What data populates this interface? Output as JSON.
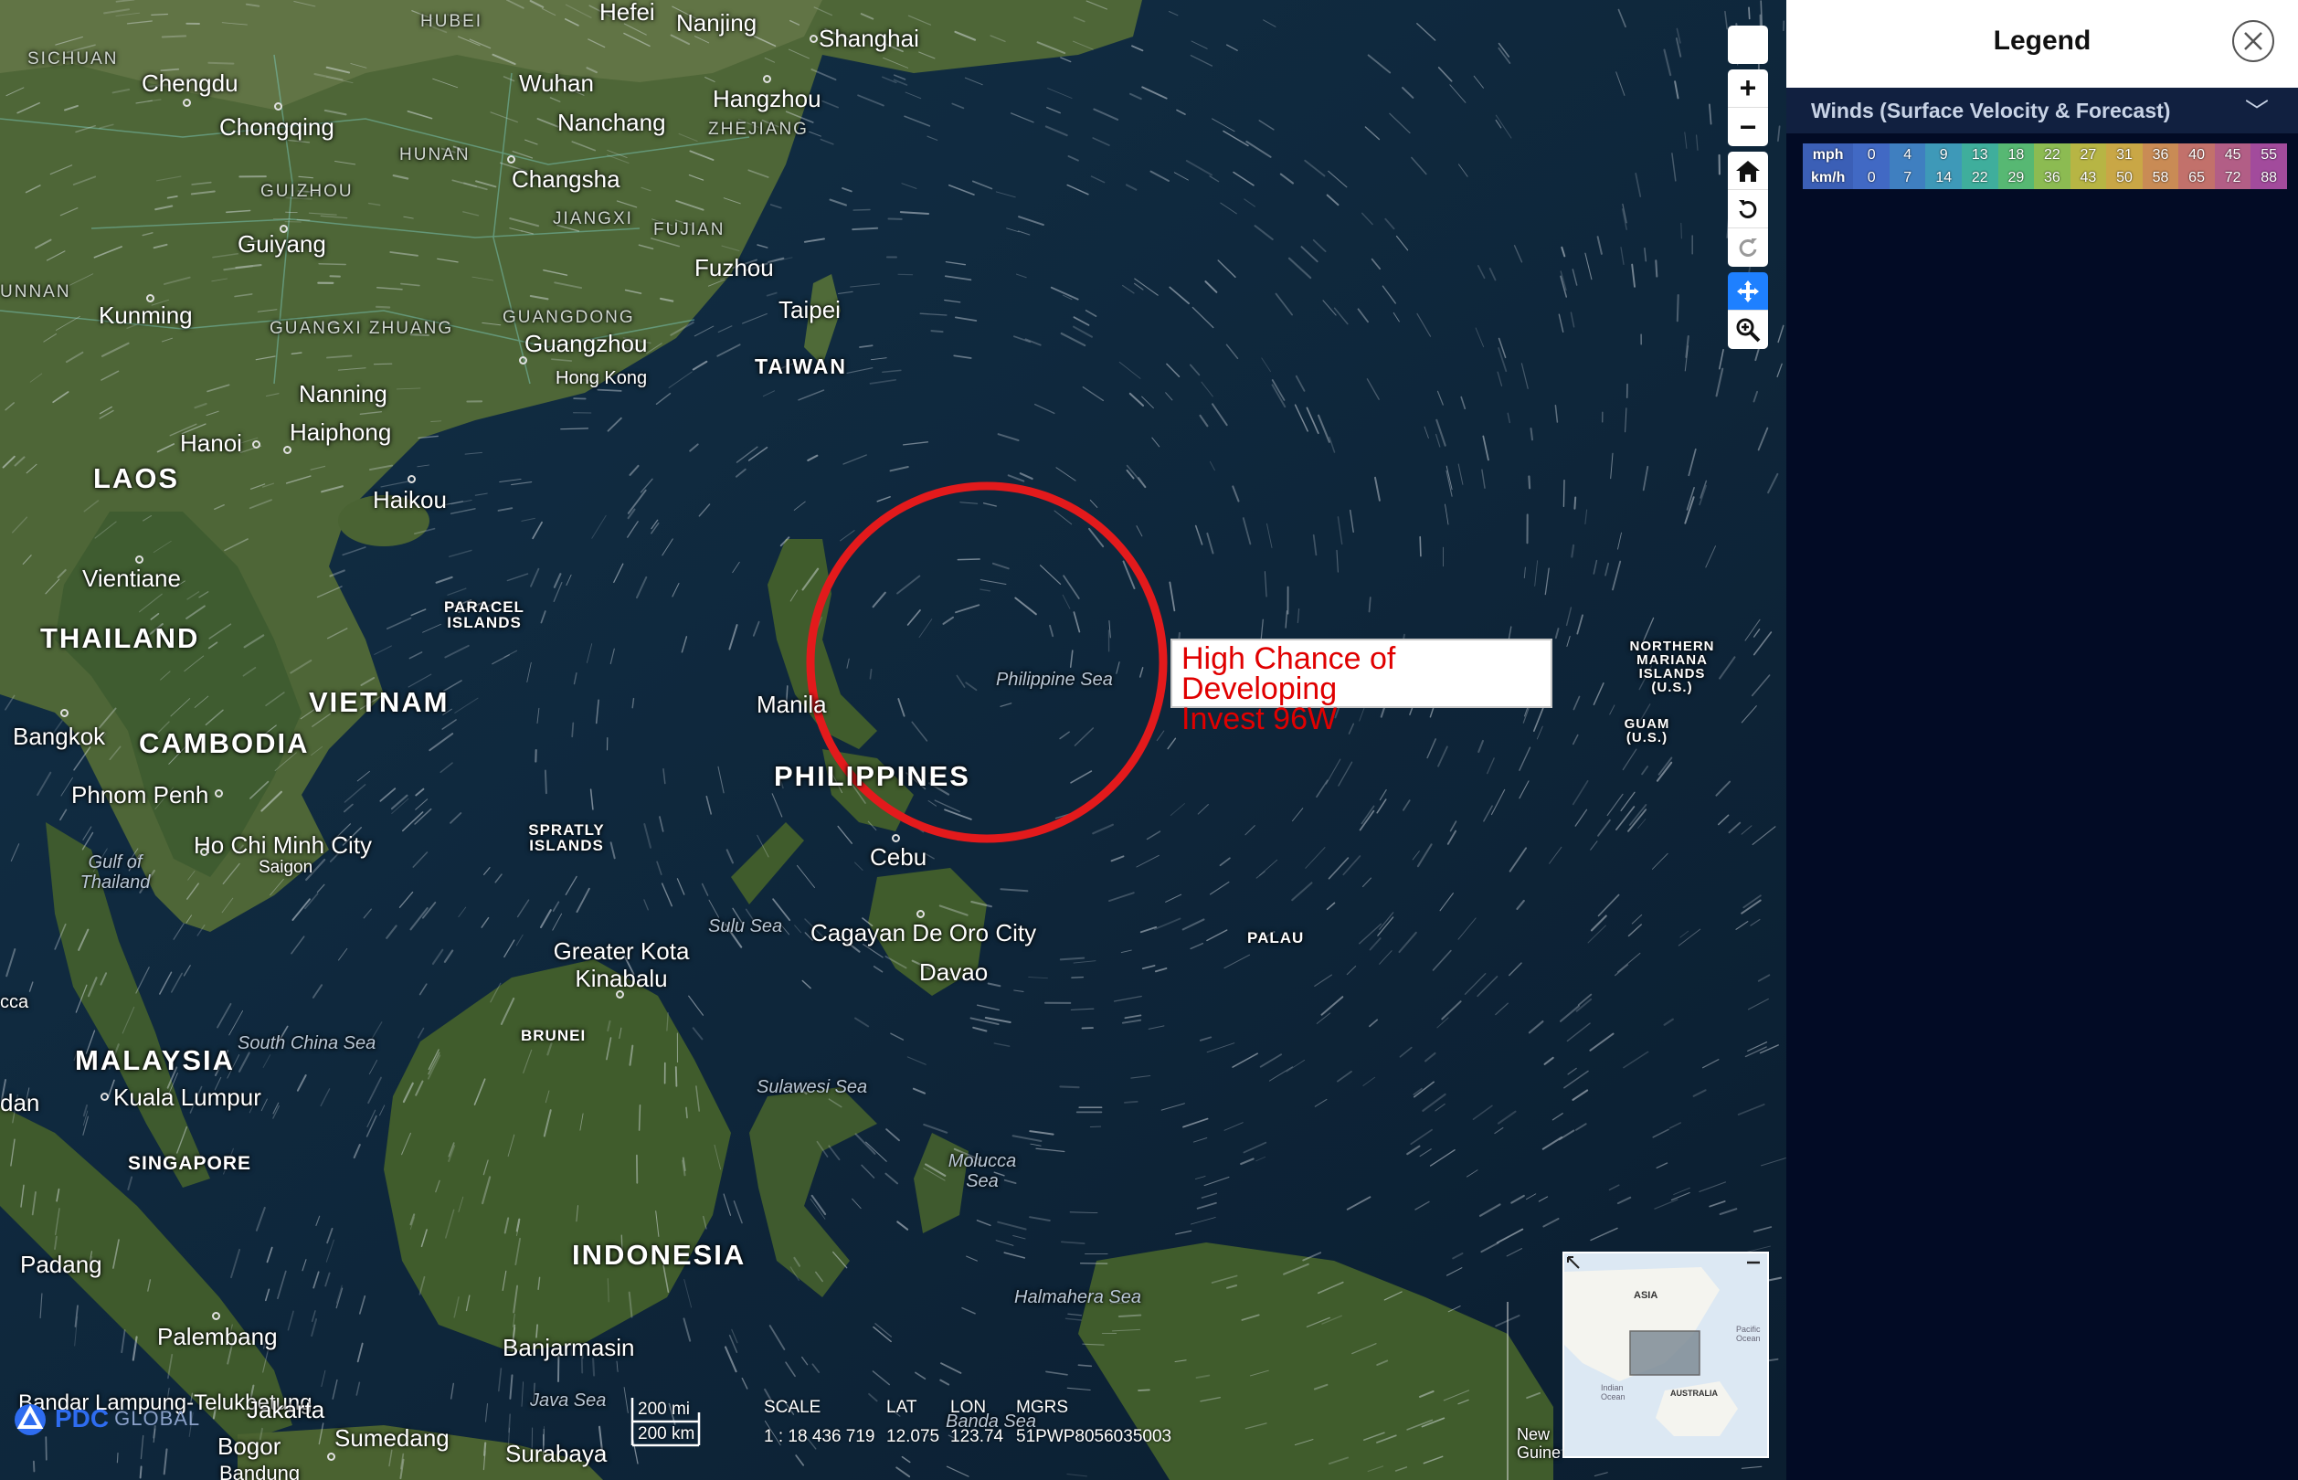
{
  "map": {
    "countries": {
      "laos": "LAOS",
      "thailand": "THAILAND",
      "vietnam": "VIETNAM",
      "cambodia": "CAMBODIA",
      "philippines": "PHILIPPINES",
      "malaysia": "MALAYSIA",
      "indonesia": "INDONESIA",
      "taiwan": "TAIWAN"
    },
    "cities": {
      "hefei": "Hefei",
      "nanjing": "Nanjing",
      "shanghai": "Shanghai",
      "chengdu": "Chengdu",
      "wuhan": "Wuhan",
      "hangzhou": "Hangzhou",
      "chongqing": "Chongqing",
      "nanchang": "Nanchang",
      "changsha": "Changsha",
      "guiyang": "Guiyang",
      "fuzhou": "Fuzhou",
      "kunming": "Kunming",
      "taipei": "Taipei",
      "guangzhou": "Guangzhou",
      "hongkong": "Hong Kong",
      "nanning": "Nanning",
      "haiphong": "Haiphong",
      "hanoi": "Hanoi",
      "haikou": "Haikou",
      "vientiane": "Vientiane",
      "manila": "Manila",
      "bangkok": "Bangkok",
      "phnompenh": "Phnom Penh",
      "hochiminh": "Ho Chi Minh City",
      "saigon": "Saigon",
      "cebu": "Cebu",
      "cagayan": "Cagayan De Oro City",
      "davao": "Davao",
      "kotakinabalu": "Greater Kota Kinabalu",
      "kualalumpur": "Kuala Lumpur",
      "padang": "Padang",
      "palembang": "Palembang",
      "banjarmasin": "Banjarmasin",
      "telukbetung": "Bandar Lampung-Telukbetung",
      "jakarta": "Jakarta",
      "bogor": "Bogor",
      "sumedang": "Sumedang",
      "surabaya": "Surabaya",
      "bandung": "Bandung",
      "dan": "dan",
      "unnan": "UNNAN",
      "cca": "cca"
    },
    "regions": {
      "sichuan": "SICHUAN",
      "hubei": "HUBEI",
      "zhejiang": "ZHEJIANG",
      "hunan": "HUNAN",
      "guizhou": "GUIZHOU",
      "jiangxi": "JIANGXI",
      "fujian": "FUJIAN",
      "guangxi": "GUANGXI ZHUANG",
      "guangdong": "GUANGDONG",
      "paracel": "PARACEL ISLANDS",
      "spratly": "SPRATLY ISLANDS",
      "brunei": "BRUNEI",
      "singapore": "SINGAPORE",
      "palau": "PALAU",
      "nmariana": "NORTHERN MARIANA ISLANDS (U.S.)",
      "guam": "GUAM (U.S.)"
    },
    "waters": {
      "philippinesea": "Philippine Sea",
      "gulfthailand": "Gulf of Thailand",
      "southchinasea": "South China Sea",
      "sulusea": "Sulu Sea",
      "sulawesisea": "Sulawesi Sea",
      "moluccasea": "Molucca Sea",
      "halmaherasea": "Halmahera Sea",
      "javasea": "Java Sea",
      "bandasea": "Banda Sea"
    },
    "invest_callout": {
      "line1": "High Chance of Developing",
      "line2": "Invest 96W",
      "circle_color": "#e31a1c"
    },
    "overview": {
      "asia": "ASIA",
      "pacific": "Pacific Ocean",
      "indian": "Indian Ocean",
      "australia": "AUSTRALIA",
      "new_guinea": "New Guine"
    }
  },
  "toolbar": {
    "icons": [
      "blank-button",
      "zoom-in-icon",
      "zoom-out-icon",
      "home-icon",
      "rotate-left-icon",
      "rotate-right-icon",
      "pan-icon",
      "zoom-box-icon"
    ],
    "zoom_in": "+",
    "zoom_out": "−"
  },
  "scale": {
    "mi": "200 mi",
    "km": "200 km"
  },
  "coords": {
    "scale_label": "SCALE",
    "scale_value": "1 : 18 436 719",
    "lat_label": "LAT",
    "lat_value": "12.075",
    "lon_label": "LON",
    "lon_value": "123.74",
    "mgrs_label": "MGRS",
    "mgrs_value": "51PWP8056035003"
  },
  "logo": {
    "text": "PDC",
    "global": "GLOBAL"
  },
  "legend": {
    "title": "Legend",
    "close_icon": "close-icon",
    "layer_name": "Winds (Surface Velocity & Forecast)",
    "chevron": "﹀",
    "units": [
      "mph",
      "km/h"
    ],
    "mph": [
      "0",
      "4",
      "9",
      "13",
      "18",
      "22",
      "27",
      "31",
      "36",
      "40",
      "45",
      "55"
    ],
    "kmh": [
      "0",
      "7",
      "14",
      "22",
      "29",
      "36",
      "43",
      "50",
      "58",
      "65",
      "72",
      "88"
    ],
    "colors": [
      "#4169c4",
      "#3f7fc0",
      "#3e99b8",
      "#3fae9c",
      "#57b873",
      "#8cbb52",
      "#b7b544",
      "#c9a746",
      "#c98b55",
      "#c2716b",
      "#b25e86",
      "#a24b9c"
    ]
  }
}
